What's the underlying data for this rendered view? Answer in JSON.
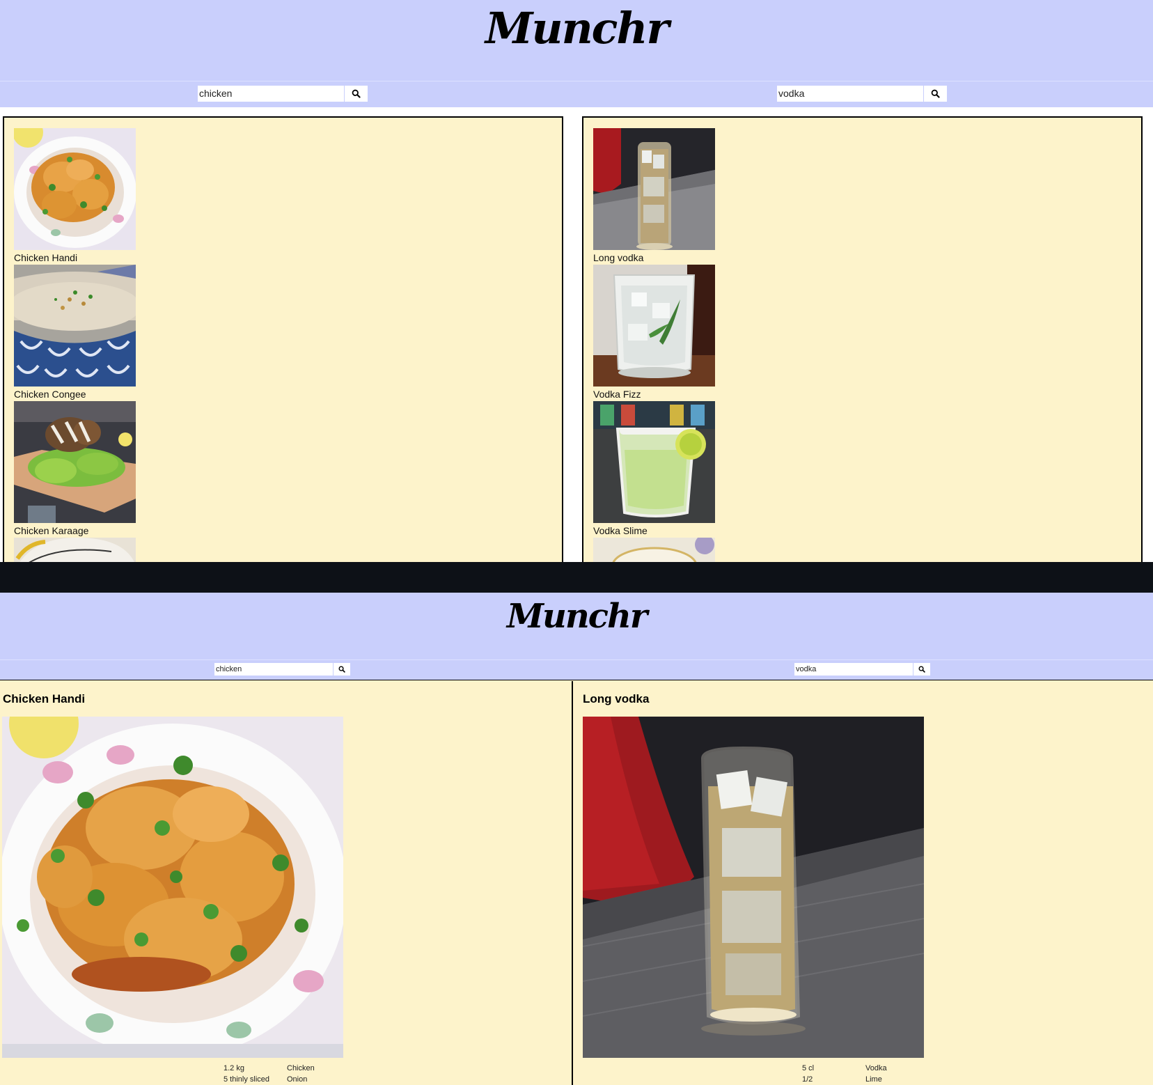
{
  "app": {
    "logo": "Munchr"
  },
  "searches": {
    "food": {
      "value": "chicken"
    },
    "drink": {
      "value": "vodka"
    }
  },
  "food_results": [
    {
      "name": "Chicken Handi"
    },
    {
      "name": "Chicken Congee"
    },
    {
      "name": "Chicken Karaage"
    }
  ],
  "drink_results": [
    {
      "name": "Long vodka"
    },
    {
      "name": "Vodka Fizz"
    },
    {
      "name": "Vodka Slime"
    }
  ],
  "food_detail": {
    "title": "Chicken Handi",
    "ingredients": [
      {
        "qty": "1.2 kg",
        "item": "Chicken"
      },
      {
        "qty": "5 thinly sliced",
        "item": "Onion"
      }
    ]
  },
  "drink_detail": {
    "title": "Long vodka",
    "ingredients": [
      {
        "qty": "5 cl",
        "item": "Vodka"
      },
      {
        "qty": "1/2",
        "item": "Lime"
      }
    ]
  },
  "icons": {
    "search": "search-icon"
  },
  "colors": {
    "header": "#c9cffc",
    "panel": "#fdf3cb",
    "divider": "#0d1117"
  }
}
